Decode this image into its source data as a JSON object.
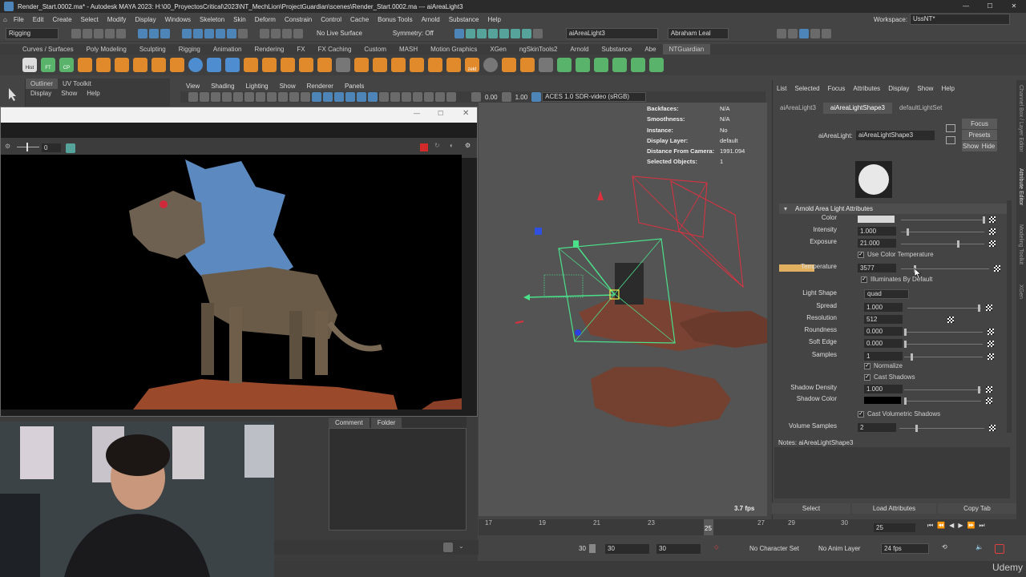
{
  "window": {
    "title": "Render_Start.0002.ma* - Autodesk MAYA 2023: H:\\00_ProyectosCritical\\2023\\NT_MechLion\\ProjectGuardian\\scenes\\Render_Start.0002.ma  ---  aiAreaLight3",
    "workspace_label": "Workspace:",
    "workspace_value": "UssNT*"
  },
  "menus": [
    "File",
    "Edit",
    "Create",
    "Select",
    "Modify",
    "Display",
    "Windows",
    "Skeleton",
    "Skin",
    "Deform",
    "Constrain",
    "Control",
    "Cache",
    "Bonus Tools",
    "Arnold",
    "Substance",
    "Help"
  ],
  "status": {
    "mode": "Rigging",
    "live_surface": "No Live Surface",
    "symmetry": "Symmetry: Off",
    "object_name": "aiAreaLight3",
    "user": "Abraham Leal"
  },
  "shelf_tabs": [
    "Curves / Surfaces",
    "Poly Modeling",
    "Sculpting",
    "Rigging",
    "Animation",
    "Rendering",
    "FX",
    "FX Caching",
    "Custom",
    "MASH",
    "Motion Graphics",
    "XGen",
    "ngSkinTools2",
    "Arnold",
    "Substance",
    "Abe",
    "NTGuardian"
  ],
  "shelf_labels": {
    "hist": "Hist",
    "ft": "FT",
    "cp": "CP",
    "zeld": "zeld"
  },
  "outliner": {
    "tabs": [
      "Outliner",
      "UV Toolkit"
    ],
    "menu": [
      "Display",
      "Show",
      "Help"
    ]
  },
  "viewport": {
    "menu": [
      "View",
      "Shading",
      "Lighting",
      "Show",
      "Renderer",
      "Panels"
    ],
    "exposure": "0.00",
    "gamma": "1.00",
    "colorspace": "ACES 1.0 SDR-video (sRGB)",
    "fps": "3.7 fps",
    "hud": [
      {
        "k": "Backfaces:",
        "v": "N/A"
      },
      {
        "k": "Smoothness:",
        "v": "N/A"
      },
      {
        "k": "Instance:",
        "v": "No"
      },
      {
        "k": "Display Layer:",
        "v": "default"
      },
      {
        "k": "Distance From Camera:",
        "v": "1991.094"
      },
      {
        "k": "Selected Objects:",
        "v": "1"
      }
    ]
  },
  "render_window": {
    "value": "0"
  },
  "comment_tabs": [
    "Comment",
    "Folder"
  ],
  "timeline": {
    "ticks": [
      "17",
      "19",
      "21",
      "23",
      "25",
      "27",
      "29",
      "30"
    ],
    "current": "25",
    "current_frame_field": "25"
  },
  "range": {
    "end1": "30",
    "end2": "30",
    "end3": "30",
    "character": "No Character Set",
    "anim_layer": "No Anim Layer",
    "fps": "24 fps"
  },
  "attribute_editor": {
    "menu": [
      "List",
      "Selected",
      "Focus",
      "Attributes",
      "Display",
      "Show",
      "Help"
    ],
    "tabs": [
      "aiAreaLight3",
      "aiAreaLightShape3",
      "defaultLightSet"
    ],
    "node_label": "aiAreaLight:",
    "node_value": "aiAreaLightShape3",
    "buttons": {
      "focus": "Focus",
      "presets": "Presets",
      "show": "Show",
      "hide": "Hide"
    },
    "section": "Arnold Area Light Attributes",
    "attrs": {
      "color": "Color",
      "intensity": "Intensity",
      "intensity_v": "1.000",
      "exposure": "Exposure",
      "exposure_v": "21.000",
      "use_temp": "Use Color Temperature",
      "temperature": "Temperature",
      "temperature_v": "3577",
      "illum": "Illuminates By Default",
      "shape": "Light Shape",
      "shape_v": "quad",
      "spread": "Spread",
      "spread_v": "1.000",
      "resolution": "Resolution",
      "resolution_v": "512",
      "roundness": "Roundness",
      "roundness_v": "0.000",
      "soft_edge": "Soft Edge",
      "soft_edge_v": "0.000",
      "samples": "Samples",
      "samples_v": "1",
      "normalize": "Normalize",
      "cast_shadows": "Cast Shadows",
      "shadow_density": "Shadow Density",
      "shadow_density_v": "1.000",
      "shadow_color": "Shadow Color",
      "cast_vol": "Cast Volumetric Shadows",
      "vol_samples": "Volume Samples",
      "vol_samples_v": "2"
    },
    "notes": "Notes: aiAreaLightShape3",
    "bottom_buttons": [
      "Select",
      "Load Attributes",
      "Copy Tab"
    ]
  },
  "right_strip": [
    "Channel Box / Layer Editor",
    "Attribute Editor",
    "Modeling Toolkit",
    "XGen"
  ],
  "watermark": "Udemy",
  "colors": {
    "accent": "#4d85b8",
    "temp_swatch": "#e0b060",
    "wire_red": "#e03040",
    "wire_green": "#40e080"
  }
}
